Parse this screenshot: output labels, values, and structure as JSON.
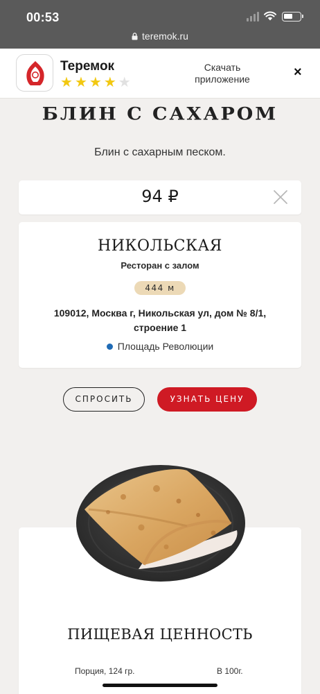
{
  "status_bar": {
    "time": "00:53",
    "icons": [
      "signal-icon",
      "wifi-icon",
      "battery-icon"
    ]
  },
  "url_bar": {
    "domain": "teremok.ru",
    "icon": "lock-icon"
  },
  "app_banner": {
    "app_name": "Теремок",
    "rating": 4,
    "rating_max": 5,
    "download_label_line1": "Скачать",
    "download_label_line2": "приложение",
    "close_label": "×",
    "icon": "teremok-logo-icon"
  },
  "product": {
    "title": "БЛИН С САХАРОМ",
    "description": "Блин с сахарным песком."
  },
  "price_card": {
    "price": "94 ₽",
    "icon": "close-icon"
  },
  "restaurant": {
    "name": "НИКОЛЬСКАЯ",
    "type": "Ресторан с залом",
    "distance": "444 м",
    "address": "109012, Москва г, Никольская ул, дом № 8/1, строение 1",
    "metro": "Площадь Революции",
    "metro_color": "#1f6bb5"
  },
  "actions": {
    "ask_label": "СПРОСИТЬ",
    "find_price_label": "УЗНАТЬ ЦЕНУ"
  },
  "nutrition": {
    "title": "ПИЩЕВАЯ ЦЕННОСТЬ",
    "portion_label": "Порция, 124 гр.",
    "per_100_label": "В 100г."
  },
  "colors": {
    "accent": "#cf1a24",
    "badge": "#ecd9b6",
    "star": "#f2c811",
    "page_bg": "#f2f0ee"
  }
}
